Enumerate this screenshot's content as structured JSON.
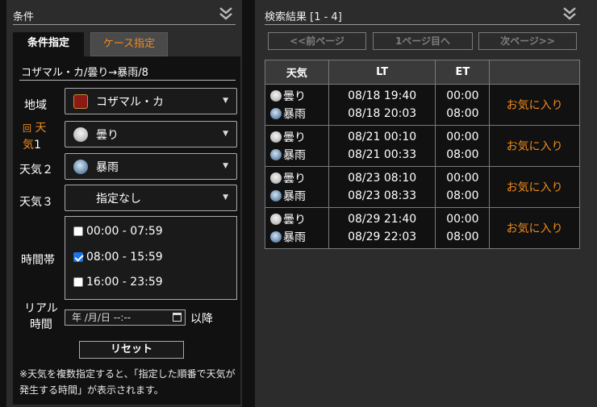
{
  "left": {
    "title": "条件",
    "tabs": [
      {
        "label": "条件指定",
        "active": true
      },
      {
        "label": "ケース指定",
        "active": false
      }
    ],
    "summary": "コザマル・カ/曇り→暴雨/8",
    "fields": {
      "zone": {
        "label": "地域",
        "value": "コザマル・カ",
        "icon": "zone-emblem-icon"
      },
      "weather1": {
        "label_prefix": "回",
        "label_a": "天",
        "label_b": "気",
        "label_num": "1",
        "value": "曇り",
        "icon": "cloud-icon"
      },
      "weather2": {
        "label": "天気２",
        "value": "暴雨",
        "icon": "rain-icon"
      },
      "weather3": {
        "label": "天気３",
        "value": "指定なし"
      }
    },
    "time_label": "時間帯",
    "time_slots": [
      {
        "label": "00:00 - 07:59",
        "checked": false
      },
      {
        "label": "08:00 - 15:59",
        "checked": true
      },
      {
        "label": "16:00 - 23:59",
        "checked": false
      }
    ],
    "real_time_label_1": "リアル",
    "real_time_label_2": "時間",
    "date_placeholder": "年 /月/日 --:--",
    "date_suffix": "以降",
    "reset_label": "リセット",
    "note": "※天気を複数指定すると、「指定した順番で天気が発生する時間」が表示されます。"
  },
  "right": {
    "title": "検索結果 [1 - 4]",
    "pager": {
      "prev": "<<前ページ",
      "first": "1ページ目へ",
      "next": "次ページ>>"
    },
    "columns": [
      "天気",
      "LT",
      "ET",
      ""
    ],
    "rows": [
      {
        "w1": "曇り",
        "w2": "暴雨",
        "lt1": "08/18 19:40",
        "lt2": "08/18 20:03",
        "et1": "00:00",
        "et2": "08:00",
        "fav": "お気に入り"
      },
      {
        "w1": "曇り",
        "w2": "暴雨",
        "lt1": "08/21 00:10",
        "lt2": "08/21 00:33",
        "et1": "00:00",
        "et2": "08:00",
        "fav": "お気に入り"
      },
      {
        "w1": "曇り",
        "w2": "暴雨",
        "lt1": "08/23 08:10",
        "lt2": "08/23 08:33",
        "et1": "00:00",
        "et2": "08:00",
        "fav": "お気に入り"
      },
      {
        "w1": "曇り",
        "w2": "暴雨",
        "lt1": "08/29 21:40",
        "lt2": "08/29 22:03",
        "et1": "00:00",
        "et2": "08:00",
        "fav": "お気に入り"
      }
    ]
  },
  "colors": {
    "accent": "#f08a1e",
    "panel": "#2c2c2c",
    "background": "#111111",
    "check": "#1a73e8"
  }
}
